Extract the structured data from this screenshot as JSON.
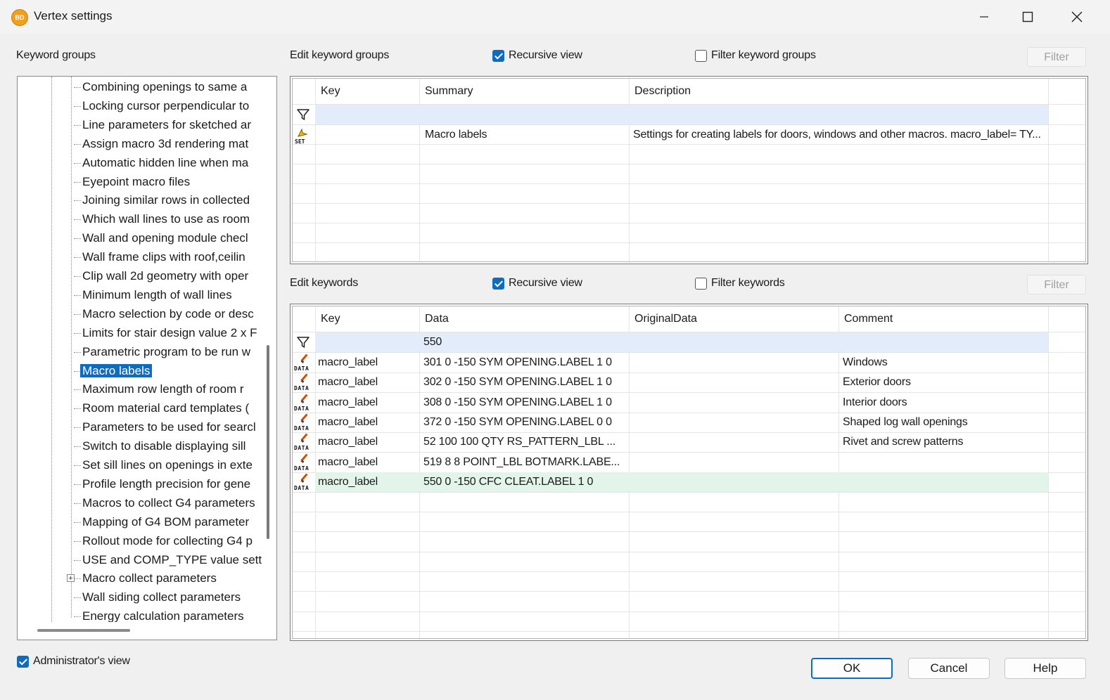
{
  "window": {
    "title": "Vertex settings",
    "app_icon_text": "BD",
    "controls": [
      "minimize-icon",
      "maximize-icon",
      "close-icon"
    ]
  },
  "keyword_groups": {
    "label": "Keyword groups",
    "items": [
      "Combining openings to same a",
      "Locking cursor perpendicular to",
      "Line parameters for sketched ar",
      "Assign macro 3d rendering mat",
      "Automatic hidden line when ma",
      "Eyepoint macro files",
      "Joining similar rows in collected",
      "Which wall lines to use as room",
      "Wall and opening module checl",
      "Wall frame clips with roof,ceilin",
      "Clip wall 2d geometry with oper",
      "Minimum length of wall lines",
      "Macro selection by code or desc",
      "Limits for stair design value 2 x F",
      "Parametric program to be run w",
      "Macro labels",
      "Maximum row length of room r",
      "Room material card templates (",
      "Parameters to be used for searcl",
      "Switch to disable displaying sill",
      "Set sill lines on openings in exte",
      "Profile length precision for gene",
      "Macros to collect G4 parameters",
      "Mapping of G4 BOM parameter",
      "Rollout mode for collecting G4 p",
      "USE and COMP_TYPE value sett",
      "Macro collect parameters",
      "Wall siding collect parameters",
      "Energy calculation parameters"
    ],
    "selected": "Macro labels",
    "expandable": "Macro collect parameters"
  },
  "edit_groups": {
    "label": "Edit keyword groups",
    "recursive_label": "Recursive view",
    "recursive_checked": true,
    "filter_label": "Filter keyword groups",
    "filter_checked": false,
    "filter_button": "Filter",
    "columns": [
      "Key",
      "Summary",
      "Description"
    ],
    "rows": [
      {
        "icon": "SET",
        "key": "",
        "summary": "Macro labels",
        "description": "Settings for creating labels for doors, windows and other macros. macro_label= TY..."
      }
    ]
  },
  "edit_keywords": {
    "label": "Edit keywords",
    "recursive_label": "Recursive view",
    "recursive_checked": true,
    "filter_label": "Filter keywords",
    "filter_checked": false,
    "filter_button": "Filter",
    "columns": [
      "Key",
      "Data",
      "OriginalData",
      "Comment"
    ],
    "filter_row": {
      "key": "",
      "data": "550",
      "original": "",
      "comment": ""
    },
    "rows": [
      {
        "icon": "DATA",
        "key": "macro_label",
        "data": "301 0 -150 SYM OPENING.LABEL 1 0",
        "original": "",
        "comment": "Windows"
      },
      {
        "icon": "DATA",
        "key": "macro_label",
        "data": "302 0 -150 SYM OPENING.LABEL 1 0",
        "original": "",
        "comment": "Exterior doors"
      },
      {
        "icon": "DATA",
        "key": "macro_label",
        "data": "308 0 -150 SYM OPENING.LABEL 1 0",
        "original": "",
        "comment": "Interior doors"
      },
      {
        "icon": "DATA",
        "key": "macro_label",
        "data": "372 0 -150 SYM OPENING.LABEL 0 0",
        "original": "",
        "comment": "Shaped log wall openings"
      },
      {
        "icon": "DATA",
        "key": "macro_label",
        "data": "52 100 100 QTY RS_PATTERN_LBL ...",
        "original": "",
        "comment": "Rivet and screw patterns"
      },
      {
        "icon": "DATA",
        "key": "macro_label",
        "data": "519 8 8 POINT_LBL BOTMARK.LABE...",
        "original": "",
        "comment": ""
      },
      {
        "icon": "DATA",
        "key": "macro_label",
        "data": "550 0 -150 CFC CLEAT.LABEL 1 0",
        "original": "",
        "comment": ""
      }
    ],
    "highlighted_row": 6
  },
  "footer": {
    "admin_label": "Administrator's view",
    "admin_checked": true,
    "ok": "OK",
    "cancel": "Cancel",
    "help": "Help"
  },
  "colors": {
    "accent": "#0f6cbd",
    "filter_row": "#e3ecfb",
    "highlight_row": "#e3f5ea"
  }
}
